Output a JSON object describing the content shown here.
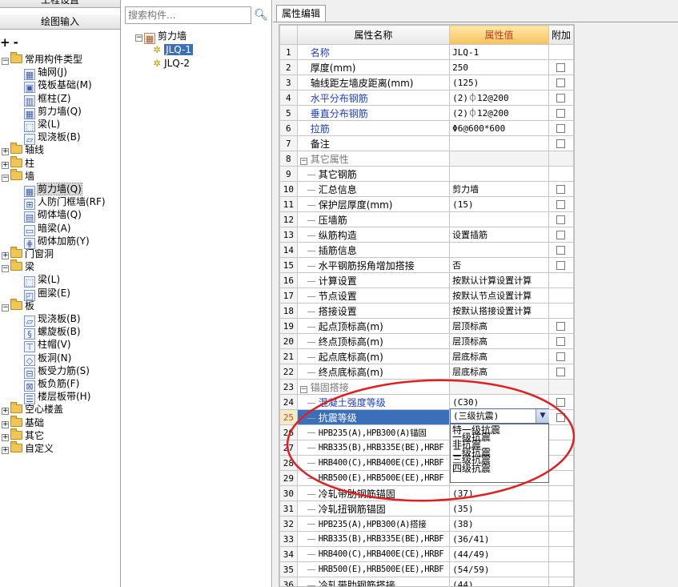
{
  "left": {
    "tab_top": "工程设置",
    "tab_bottom": "绘图输入",
    "expand_symbol": "+",
    "collapse_symbol": "-",
    "tree": [
      {
        "label": "常用构件类型",
        "kind": "folder",
        "open": true
      },
      {
        "label": "轴网(J)",
        "kind": "leaf",
        "icon": "grid-icon"
      },
      {
        "label": "筏板基础(M)",
        "kind": "leaf",
        "icon": "raft-foundation-icon"
      },
      {
        "label": "框柱(Z)",
        "kind": "leaf",
        "icon": "column-icon"
      },
      {
        "label": "剪力墙(Q)",
        "kind": "leaf",
        "icon": "shear-wall-icon"
      },
      {
        "label": "梁(L)",
        "kind": "leaf",
        "icon": "beam-icon"
      },
      {
        "label": "现浇板(B)",
        "kind": "leaf",
        "icon": "slab-icon"
      },
      {
        "label": "轴线",
        "kind": "folder",
        "open": false
      },
      {
        "label": "柱",
        "kind": "folder",
        "open": false
      },
      {
        "label": "墙",
        "kind": "folder",
        "open": true
      },
      {
        "label": "剪力墙(Q)",
        "kind": "leaf",
        "icon": "shear-wall-icon",
        "selected": true
      },
      {
        "label": "人防门框墙(RF)",
        "kind": "leaf",
        "icon": "civil-defense-door-wall-icon"
      },
      {
        "label": "砌体墙(Q)",
        "kind": "leaf",
        "icon": "masonry-wall-icon"
      },
      {
        "label": "暗梁(A)",
        "kind": "leaf",
        "icon": "hidden-beam-icon"
      },
      {
        "label": "砌体加筋(Y)",
        "kind": "leaf",
        "icon": "masonry-rebar-icon"
      },
      {
        "label": "门窗洞",
        "kind": "folder",
        "open": false
      },
      {
        "label": "梁",
        "kind": "folder",
        "open": true
      },
      {
        "label": "梁(L)",
        "kind": "leaf",
        "icon": "beam-icon"
      },
      {
        "label": "圈梁(E)",
        "kind": "leaf",
        "icon": "ring-beam-icon"
      },
      {
        "label": "板",
        "kind": "folder",
        "open": true
      },
      {
        "label": "现浇板(B)",
        "kind": "leaf",
        "icon": "slab-icon"
      },
      {
        "label": "螺旋板(B)",
        "kind": "leaf",
        "icon": "spiral-slab-icon"
      },
      {
        "label": "柱帽(V)",
        "kind": "leaf",
        "icon": "column-cap-icon"
      },
      {
        "label": "板洞(N)",
        "kind": "leaf",
        "icon": "slab-hole-icon"
      },
      {
        "label": "板受力筋(S)",
        "kind": "leaf",
        "icon": "slab-main-rebar-icon"
      },
      {
        "label": "板负筋(F)",
        "kind": "leaf",
        "icon": "slab-negative-rebar-icon"
      },
      {
        "label": "楼层板带(H)",
        "kind": "leaf",
        "icon": "floor-strip-icon"
      },
      {
        "label": "空心楼盖",
        "kind": "folder",
        "open": false
      },
      {
        "label": "基础",
        "kind": "folder",
        "open": false
      },
      {
        "label": "其它",
        "kind": "folder",
        "open": false
      },
      {
        "label": "自定义",
        "kind": "folder",
        "open": false
      }
    ]
  },
  "middle": {
    "search_placeholder": "搜索构件...",
    "root": "剪力墙",
    "items": [
      "JLQ-1",
      "JLQ-2"
    ],
    "selected_index": 0
  },
  "right": {
    "tab_label": "属性编辑",
    "columns": {
      "num": "",
      "name": "属性名称",
      "value": "属性值",
      "extra": "附加"
    },
    "rows": [
      {
        "no": "1",
        "name": "名称",
        "value": "JLQ-1",
        "blue": true,
        "check": false
      },
      {
        "no": "2",
        "name": "厚度(mm)",
        "value": "250",
        "check": true
      },
      {
        "no": "3",
        "name": "轴线距左墙皮距离(mm)",
        "value": "(125)",
        "check": true
      },
      {
        "no": "4",
        "name": "水平分布钢筋",
        "value": "(2)⏀12@200",
        "blue": true,
        "check": true
      },
      {
        "no": "5",
        "name": "垂直分布钢筋",
        "value": "(2)⏀12@200",
        "blue": true,
        "check": true
      },
      {
        "no": "6",
        "name": "拉筋",
        "value": "Φ6@600*600",
        "blue": true,
        "check": true
      },
      {
        "no": "7",
        "name": "备注",
        "value": "",
        "check": true
      },
      {
        "no": "8",
        "name": "其它属性",
        "value": "",
        "group": true
      },
      {
        "no": "9",
        "name": "其它钢筋",
        "value": "",
        "indent": true
      },
      {
        "no": "10",
        "name": "汇总信息",
        "value": "剪力墙",
        "indent": true,
        "check": true
      },
      {
        "no": "11",
        "name": "保护层厚度(mm)",
        "value": "(15)",
        "indent": true,
        "check": true
      },
      {
        "no": "12",
        "name": "压墙筋",
        "value": "",
        "indent": true,
        "check": true
      },
      {
        "no": "13",
        "name": "纵筋构造",
        "value": "设置插筋",
        "indent": true,
        "check": true
      },
      {
        "no": "14",
        "name": "插筋信息",
        "value": "",
        "indent": true,
        "check": true
      },
      {
        "no": "15",
        "name": "水平钢筋拐角增加搭接",
        "value": "否",
        "indent": true,
        "check": true
      },
      {
        "no": "16",
        "name": "计算设置",
        "value": "按默认计算设置计算",
        "indent": true
      },
      {
        "no": "17",
        "name": "节点设置",
        "value": "按默认节点设置计算",
        "indent": true
      },
      {
        "no": "18",
        "name": "搭接设置",
        "value": "按默认搭接设置计算",
        "indent": true
      },
      {
        "no": "19",
        "name": "起点顶标高(m)",
        "value": "层顶标高",
        "indent": true,
        "check": true
      },
      {
        "no": "20",
        "name": "终点顶标高(m)",
        "value": "层顶标高",
        "indent": true,
        "check": true
      },
      {
        "no": "21",
        "name": "起点底标高(m)",
        "value": "层底标高",
        "indent": true,
        "check": true
      },
      {
        "no": "22",
        "name": "终点底标高(m)",
        "value": "层底标高",
        "indent": true,
        "check": true
      },
      {
        "no": "23",
        "name": "锚固搭接",
        "value": "",
        "group": true
      },
      {
        "no": "24",
        "name": "混凝土强度等级",
        "value": "(C30)",
        "indent": true,
        "blue": true,
        "check": true
      },
      {
        "no": "25",
        "name": "抗震等级",
        "value": "",
        "indent": true,
        "selected": true,
        "check": true
      },
      {
        "no": "26",
        "name": "HPB235(A),HPB300(A)锚固",
        "value": "",
        "indent": true,
        "mono": true
      },
      {
        "no": "27",
        "name": "HRB335(B),HRB335E(BE),HRBF",
        "value": "",
        "indent": true,
        "mono": true
      },
      {
        "no": "28",
        "name": "HRB400(C),HRB400E(CE),HRBF",
        "value": "",
        "indent": true,
        "mono": true
      },
      {
        "no": "29",
        "name": "HRB500(E),HRB500E(EE),HRBF",
        "value": "",
        "indent": true,
        "mono": true
      },
      {
        "no": "30",
        "name": "冷轧带肋钢筋锚固",
        "value": "(37)",
        "indent": true
      },
      {
        "no": "31",
        "name": "冷轧扭钢筋锚固",
        "value": "(35)",
        "indent": true
      },
      {
        "no": "32",
        "name": "HPB235(A),HPB300(A)搭接",
        "value": "(38)",
        "indent": true,
        "mono": true
      },
      {
        "no": "33",
        "name": "HRB335(B),HRB335E(BE),HRBF",
        "value": "(36/41)",
        "indent": true,
        "mono": true
      },
      {
        "no": "34",
        "name": "HRB400(C),HRB400E(CE),HRBF",
        "value": "(44/49)",
        "indent": true,
        "mono": true
      },
      {
        "no": "35",
        "name": "HRB500(E),HRB500E(EE),HRBF",
        "value": "(54/59)",
        "indent": true,
        "mono": true
      },
      {
        "no": "36",
        "name": "冷轧带肋钢筋搭接",
        "value": "(44)",
        "indent": true
      }
    ],
    "dropdown": {
      "current": "(三级抗震)",
      "arrow": "▼",
      "options": [
        "特一级抗震",
        "一级抗震",
        "非抗震",
        "二级抗震",
        "三级抗震",
        "四级抗震"
      ]
    }
  },
  "colors": {
    "highlight_ellipse": "#e02020",
    "selection": "#3b6fb9",
    "label_blue": "#1e3fc8"
  }
}
